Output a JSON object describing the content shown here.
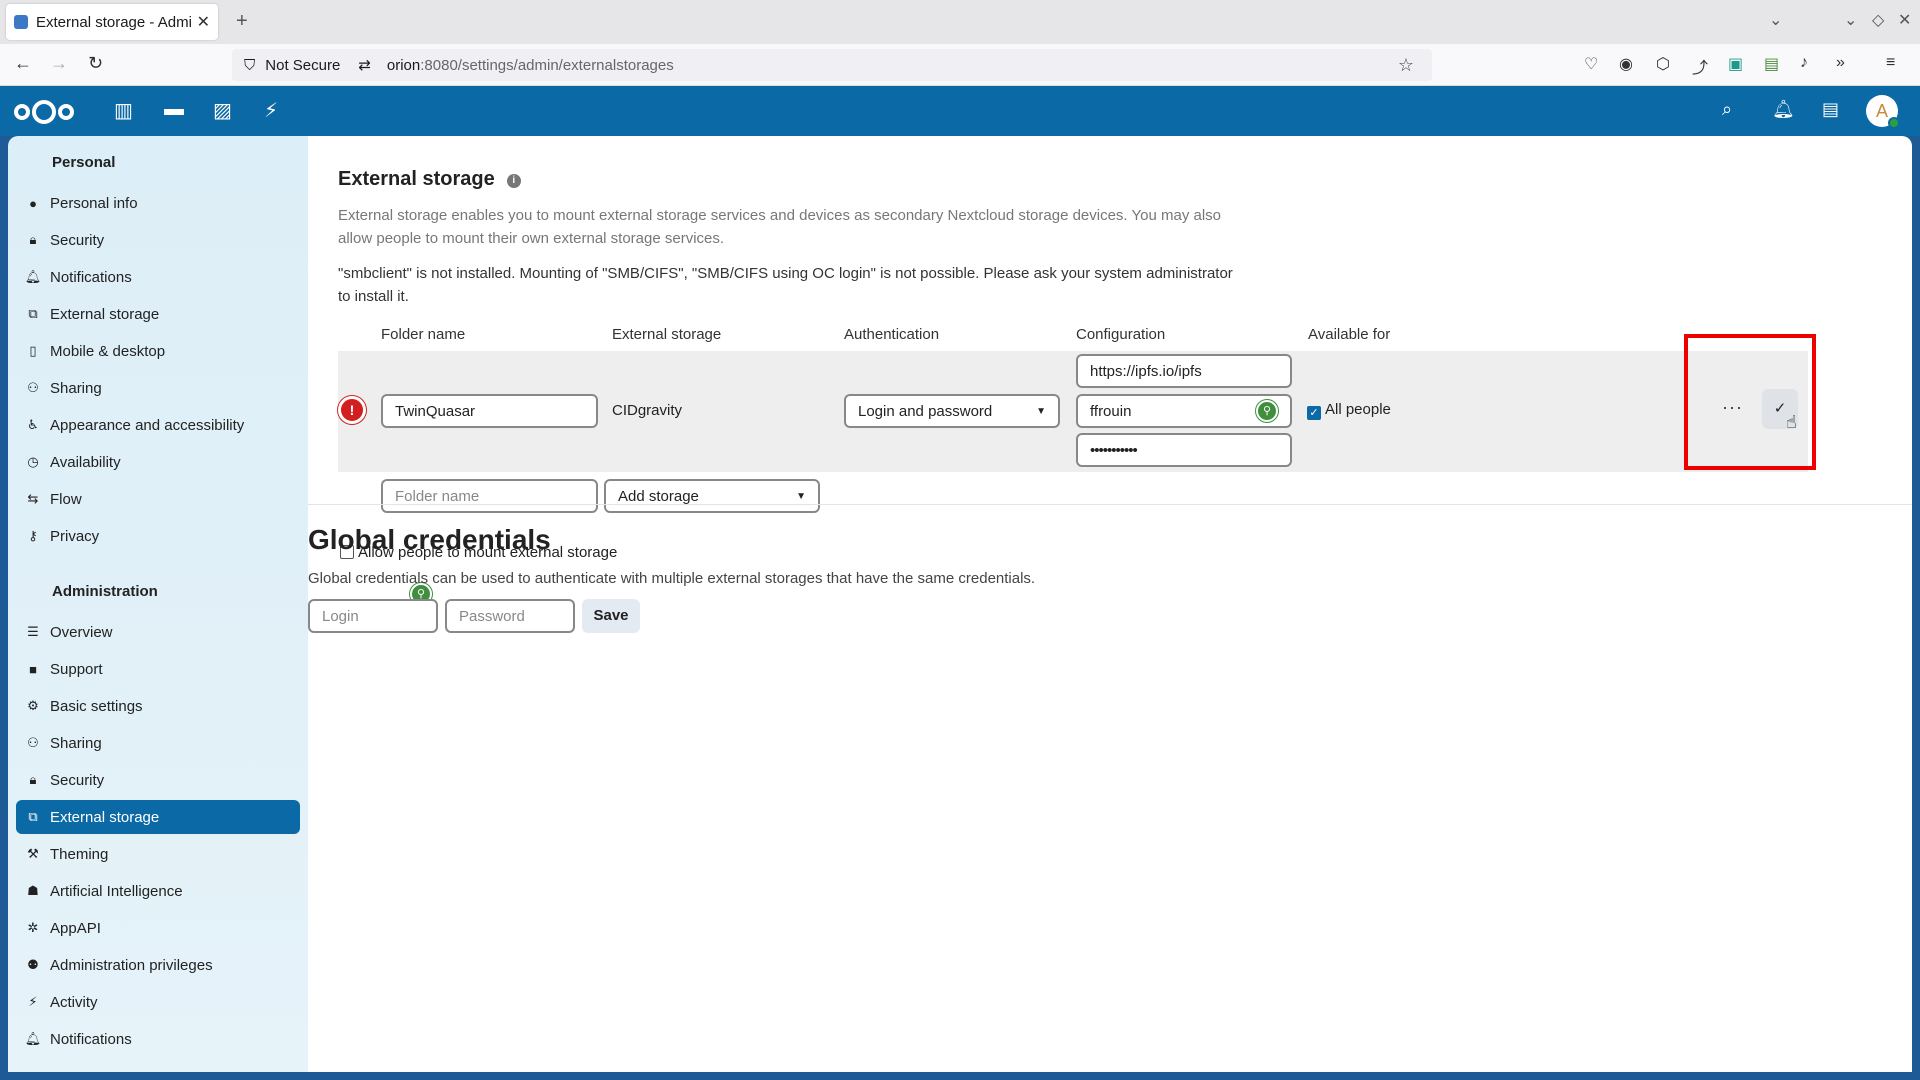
{
  "browser": {
    "tab_title": "External storage - Adminis",
    "security_label": "Not Secure",
    "url_host": "orion",
    "url_rest": ":8080/settings/admin/externalstorages"
  },
  "header": {
    "avatar_letter": "A"
  },
  "sidebar": {
    "personal_title": "Personal",
    "personal_items": [
      {
        "label": "Personal info",
        "icon": "person-icon"
      },
      {
        "label": "Security",
        "icon": "lock-icon"
      },
      {
        "label": "Notifications",
        "icon": "bell-icon"
      },
      {
        "label": "External storage",
        "icon": "external-storage-icon"
      },
      {
        "label": "Mobile & desktop",
        "icon": "phone-icon"
      },
      {
        "label": "Sharing",
        "icon": "share-icon"
      },
      {
        "label": "Appearance and accessibility",
        "icon": "accessibility-icon"
      },
      {
        "label": "Availability",
        "icon": "clock-icon"
      },
      {
        "label": "Flow",
        "icon": "flow-icon"
      },
      {
        "label": "Privacy",
        "icon": "key-icon"
      }
    ],
    "admin_title": "Administration",
    "admin_items": [
      {
        "label": "Overview",
        "icon": "sliders-icon"
      },
      {
        "label": "Support",
        "icon": "chat-icon"
      },
      {
        "label": "Basic settings",
        "icon": "gear-icon"
      },
      {
        "label": "Sharing",
        "icon": "share-icon"
      },
      {
        "label": "Security",
        "icon": "lock-icon"
      },
      {
        "label": "External storage",
        "icon": "external-storage-icon"
      },
      {
        "label": "Theming",
        "icon": "paint-roller-icon"
      },
      {
        "label": "Artificial Intelligence",
        "icon": "robot-icon"
      },
      {
        "label": "AppAPI",
        "icon": "cog-star-icon"
      },
      {
        "label": "Administration privileges",
        "icon": "admin-users-icon"
      },
      {
        "label": "Activity",
        "icon": "bolt-icon"
      },
      {
        "label": "Notifications",
        "icon": "bell-icon"
      }
    ],
    "active_item": "External storage"
  },
  "main": {
    "title": "External storage",
    "description": "External storage enables you to mount external storage services and devices as secondary Nextcloud storage devices. You may also allow people to mount their own external storage services.",
    "warning": "\"smbclient\" is not installed. Mounting of \"SMB/CIFS\", \"SMB/CIFS using OC login\" is not possible. Please ask your system administrator to install it.",
    "columns": {
      "folder": "Folder name",
      "storage": "External storage",
      "auth": "Authentication",
      "config": "Configuration",
      "available": "Available for"
    },
    "mount": {
      "folder_name": "TwinQuasar",
      "storage": "CIDgravity",
      "auth": "Login and password",
      "config_url": "https://ipfs.io/ipfs",
      "config_user": "ffrouin",
      "config_password": "•••••••••••",
      "available_for": "All people",
      "available_checked": true
    },
    "new_mount": {
      "folder_placeholder": "Folder name",
      "storage_select": "Add storage"
    },
    "allow_user_mount": "Allow people to mount external storage"
  },
  "global_credentials": {
    "title": "Global credentials",
    "description": "Global credentials can be used to authenticate with multiple external storages that have the same credentials.",
    "login_placeholder": "Login",
    "password_placeholder": "Password",
    "save_label": "Save"
  }
}
